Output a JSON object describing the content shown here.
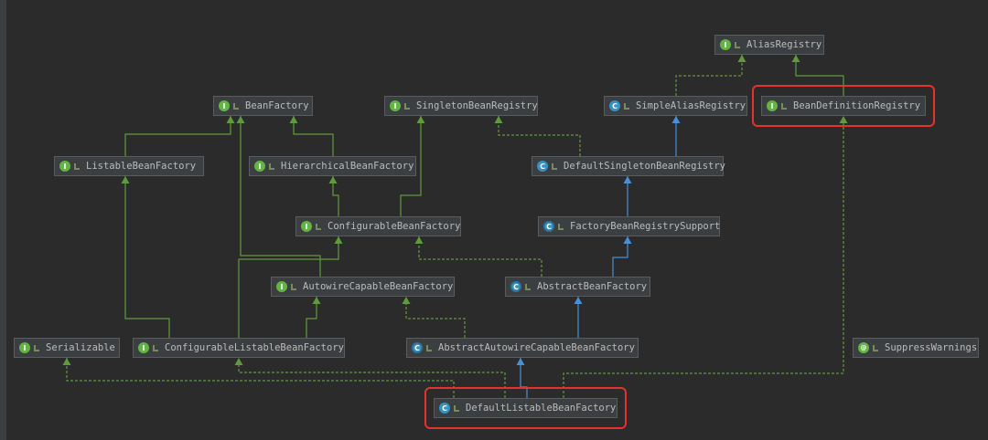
{
  "nodes": [
    {
      "id": "AliasRegistry",
      "label": "AliasRegistry",
      "kind": "interface",
      "icon": "I"
    },
    {
      "id": "BeanFactory",
      "label": "BeanFactory",
      "kind": "interface",
      "icon": "I"
    },
    {
      "id": "SingletonBeanRegistry",
      "label": "SingletonBeanRegistry",
      "kind": "interface",
      "icon": "I"
    },
    {
      "id": "SimpleAliasRegistry",
      "label": "SimpleAliasRegistry",
      "kind": "class",
      "icon": "C"
    },
    {
      "id": "BeanDefinitionRegistry",
      "label": "BeanDefinitionRegistry",
      "kind": "interface",
      "icon": "I",
      "highlighted": true
    },
    {
      "id": "ListableBeanFactory",
      "label": "ListableBeanFactory",
      "kind": "interface",
      "icon": "I"
    },
    {
      "id": "HierarchicalBeanFactory",
      "label": "HierarchicalBeanFactory",
      "kind": "interface",
      "icon": "I"
    },
    {
      "id": "DefaultSingletonBeanRegistry",
      "label": "DefaultSingletonBeanRegistry",
      "kind": "class",
      "icon": "C"
    },
    {
      "id": "ConfigurableBeanFactory",
      "label": "ConfigurableBeanFactory",
      "kind": "interface",
      "icon": "I"
    },
    {
      "id": "FactoryBeanRegistrySupport",
      "label": "FactoryBeanRegistrySupport",
      "kind": "abstract-class",
      "icon": "C"
    },
    {
      "id": "AutowireCapableBeanFactory",
      "label": "AutowireCapableBeanFactory",
      "kind": "interface",
      "icon": "I"
    },
    {
      "id": "AbstractBeanFactory",
      "label": "AbstractBeanFactory",
      "kind": "abstract-class",
      "icon": "C"
    },
    {
      "id": "Serializable",
      "label": "Serializable",
      "kind": "interface",
      "icon": "I"
    },
    {
      "id": "ConfigurableListableBeanFactory",
      "label": "ConfigurableListableBeanFactory",
      "kind": "interface",
      "icon": "I"
    },
    {
      "id": "AbstractAutowireCapableBeanFactory",
      "label": "AbstractAutowireCapableBeanFactory",
      "kind": "abstract-class",
      "icon": "C"
    },
    {
      "id": "SuppressWarnings",
      "label": "SuppressWarnings",
      "kind": "annotation",
      "icon": "@"
    },
    {
      "id": "DefaultListableBeanFactory",
      "label": "DefaultListableBeanFactory",
      "kind": "class",
      "icon": "C",
      "highlighted": true
    }
  ],
  "edges": [
    {
      "from": "SimpleAliasRegistry",
      "to": "AliasRegistry",
      "type": "implements"
    },
    {
      "from": "BeanDefinitionRegistry",
      "to": "AliasRegistry",
      "type": "extends-interface"
    },
    {
      "from": "ListableBeanFactory",
      "to": "BeanFactory",
      "type": "extends-interface"
    },
    {
      "from": "HierarchicalBeanFactory",
      "to": "BeanFactory",
      "type": "extends-interface"
    },
    {
      "from": "DefaultSingletonBeanRegistry",
      "to": "SingletonBeanRegistry",
      "type": "implements"
    },
    {
      "from": "DefaultSingletonBeanRegistry",
      "to": "SimpleAliasRegistry",
      "type": "extends"
    },
    {
      "from": "ConfigurableBeanFactory",
      "to": "HierarchicalBeanFactory",
      "type": "extends-interface"
    },
    {
      "from": "ConfigurableBeanFactory",
      "to": "SingletonBeanRegistry",
      "type": "extends-interface"
    },
    {
      "from": "FactoryBeanRegistrySupport",
      "to": "DefaultSingletonBeanRegistry",
      "type": "extends"
    },
    {
      "from": "AutowireCapableBeanFactory",
      "to": "BeanFactory",
      "type": "extends-interface"
    },
    {
      "from": "AbstractBeanFactory",
      "to": "FactoryBeanRegistrySupport",
      "type": "extends"
    },
    {
      "from": "AbstractBeanFactory",
      "to": "ConfigurableBeanFactory",
      "type": "implements"
    },
    {
      "from": "ConfigurableListableBeanFactory",
      "to": "ListableBeanFactory",
      "type": "extends-interface"
    },
    {
      "from": "ConfigurableListableBeanFactory",
      "to": "AutowireCapableBeanFactory",
      "type": "extends-interface"
    },
    {
      "from": "ConfigurableListableBeanFactory",
      "to": "ConfigurableBeanFactory",
      "type": "extends-interface"
    },
    {
      "from": "AbstractAutowireCapableBeanFactory",
      "to": "AbstractBeanFactory",
      "type": "extends"
    },
    {
      "from": "AbstractAutowireCapableBeanFactory",
      "to": "AutowireCapableBeanFactory",
      "type": "implements"
    },
    {
      "from": "DefaultListableBeanFactory",
      "to": "AbstractAutowireCapableBeanFactory",
      "type": "extends"
    },
    {
      "from": "DefaultListableBeanFactory",
      "to": "ConfigurableListableBeanFactory",
      "type": "implements"
    },
    {
      "from": "DefaultListableBeanFactory",
      "to": "Serializable",
      "type": "implements"
    },
    {
      "from": "DefaultListableBeanFactory",
      "to": "BeanDefinitionRegistry",
      "type": "implements"
    }
  ],
  "colors": {
    "background": "#2b2b2b",
    "node_fill": "#3c3f41",
    "node_border": "#5a5d5f",
    "text": "#bbbbbb",
    "interface_edge": "#5f9a3c",
    "class_edge": "#4a8fd6",
    "highlight": "#e5322d"
  }
}
